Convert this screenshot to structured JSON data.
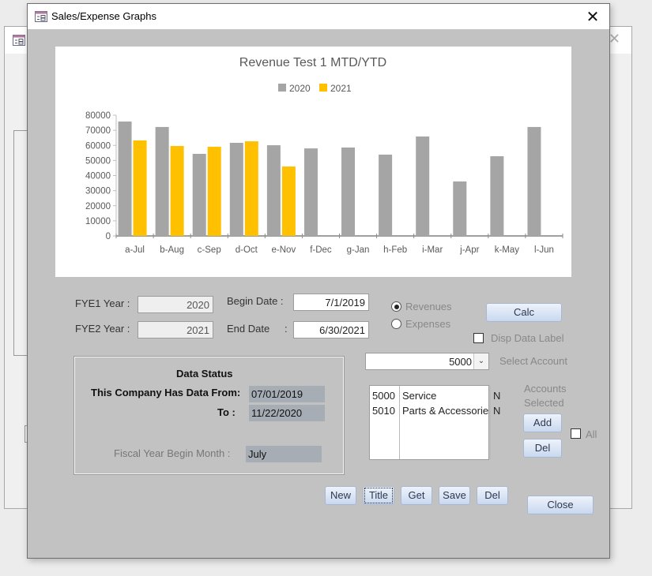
{
  "background_window": {
    "icon": "form-icon",
    "close_icon": "close-icon"
  },
  "window": {
    "title": "Sales/Expense Graphs",
    "icon": "form-icon",
    "close_label": "✕"
  },
  "chart_data": {
    "type": "bar",
    "title": "Revenue Test 1 MTD/YTD",
    "categories": [
      "a-Jul",
      "b-Aug",
      "c-Sep",
      "d-Oct",
      "e-Nov",
      "f-Dec",
      "g-Jan",
      "h-Feb",
      "i-Mar",
      "j-Apr",
      "k-May",
      "l-Jun"
    ],
    "series": [
      {
        "name": "2020",
        "color": "#a5a5a5",
        "values": [
          75800,
          72200,
          54400,
          61700,
          60100,
          58000,
          58600,
          53900,
          65900,
          36100,
          52800,
          72200
        ]
      },
      {
        "name": "2021",
        "color": "#ffc000",
        "values": [
          63300,
          59600,
          59100,
          62700,
          46000,
          null,
          null,
          null,
          null,
          null,
          null,
          null
        ]
      }
    ],
    "xlabel": "",
    "ylabel": "",
    "ylim": [
      0,
      80000
    ],
    "yticks": [
      0,
      10000,
      20000,
      30000,
      40000,
      50000,
      60000,
      70000,
      80000
    ],
    "legend": "top-center",
    "grid": false
  },
  "form": {
    "fye1_label": "FYE1 Year  :",
    "fye1_value": "2020",
    "fye2_label": "FYE2 Year  :",
    "fye2_value": "2021",
    "begin_date_label": "Begin Date  :",
    "begin_date_value": "7/1/2019",
    "end_date_label": "End Date",
    "end_date_colon": ":",
    "end_date_value": "6/30/2021",
    "radio_revenues": "Revenues",
    "radio_expenses": "Expenses",
    "selected_type": "Revenues",
    "calc_button": "Calc",
    "disp_data_label": "Disp Data Label",
    "disp_data_checked": false,
    "account_combo_value": "5000",
    "select_account_label": "Select Account"
  },
  "data_status": {
    "heading": "Data Status",
    "from_label": "This Company Has Data From:",
    "from_value": "07/01/2019",
    "to_label": "To :",
    "to_value": "11/22/2020",
    "fiscal_month_label": "Fiscal Year Begin Month :",
    "fiscal_month_value": "July"
  },
  "accounts": {
    "rows": [
      {
        "code": "5000",
        "name": "Service",
        "flag": "N"
      },
      {
        "code": "5010",
        "name": "Parts & Accessories",
        "flag": "N"
      }
    ],
    "selected_label_1": "Accounts",
    "selected_label_2": "Selected",
    "add_button": "Add",
    "del_button": "Del",
    "all_label": "All",
    "all_checked": false
  },
  "toolbar": {
    "new": "New",
    "title": "Title",
    "get": "Get",
    "save": "Save",
    "del": "Del",
    "close": "Close"
  }
}
